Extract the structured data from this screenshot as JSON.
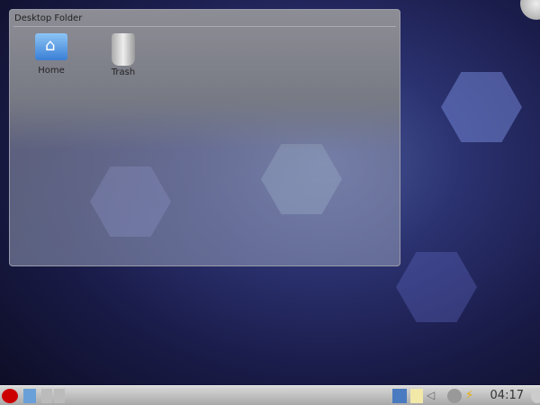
{
  "folder": {
    "title": "Desktop Folder",
    "icons": [
      {
        "label": "Home"
      },
      {
        "label": "Trash"
      }
    ]
  },
  "panel": {
    "clock": "04:17"
  }
}
